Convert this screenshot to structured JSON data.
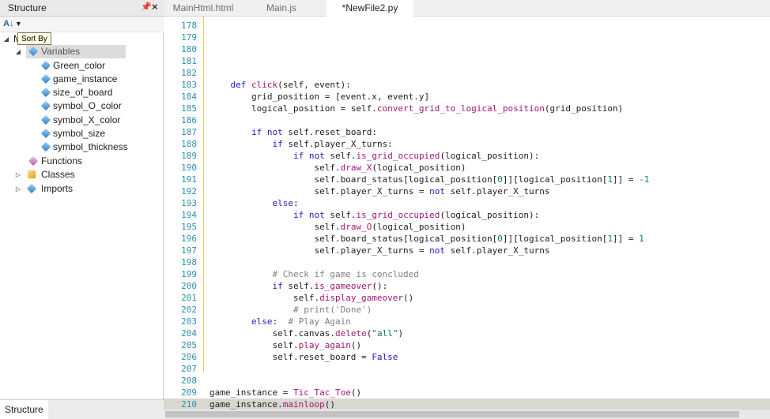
{
  "structure_panel": {
    "title": "Structure",
    "pin_icon": "pin-icon",
    "close_icon": "close-icon",
    "sort_button_tooltip": "Sort By",
    "root_label": "Main",
    "tree": [
      {
        "label": "Variables",
        "icon": "variable-icon",
        "expanded": true,
        "selected": true,
        "children": [
          "Green_color",
          "game_instance",
          "size_of_board",
          "symbol_O_color",
          "symbol_X_color",
          "symbol_size",
          "symbol_thickness"
        ]
      },
      {
        "label": "Functions",
        "icon": "function-icon"
      },
      {
        "label": "Classes",
        "icon": "class-icon",
        "collapsed": true
      },
      {
        "label": "Imports",
        "icon": "import-icon",
        "collapsed": true
      }
    ],
    "bottom_tab": "Structure"
  },
  "editor_tabs": [
    {
      "label": "MainHtml.html",
      "active": false
    },
    {
      "label": "Main.js",
      "active": false
    },
    {
      "label": "*NewFile2.py",
      "active": true
    }
  ],
  "editor": {
    "lines": [
      {
        "n": "178",
        "t": ""
      },
      {
        "n": "179",
        "t": ""
      },
      {
        "n": "180",
        "t": ""
      },
      {
        "n": "181",
        "t": ""
      },
      {
        "n": "182",
        "t": ""
      },
      {
        "n": "183",
        "t": "    def click(self, event):"
      },
      {
        "n": "184",
        "t": "        grid_position = [event.x, event.y]"
      },
      {
        "n": "185",
        "t": "        logical_position = self.convert_grid_to_logical_position(grid_position)"
      },
      {
        "n": "186",
        "t": ""
      },
      {
        "n": "187",
        "t": "        if not self.reset_board:"
      },
      {
        "n": "188",
        "t": "            if self.player_X_turns:"
      },
      {
        "n": "189",
        "t": "                if not self.is_grid_occupied(logical_position):"
      },
      {
        "n": "190",
        "t": "                    self.draw_X(logical_position)"
      },
      {
        "n": "191",
        "t": "                    self.board_status[logical_position[0]][logical_position[1]] = -1"
      },
      {
        "n": "192",
        "t": "                    self.player_X_turns = not self.player_X_turns"
      },
      {
        "n": "193",
        "t": "            else:"
      },
      {
        "n": "194",
        "t": "                if not self.is_grid_occupied(logical_position):"
      },
      {
        "n": "195",
        "t": "                    self.draw_O(logical_position)"
      },
      {
        "n": "196",
        "t": "                    self.board_status[logical_position[0]][logical_position[1]] = 1"
      },
      {
        "n": "197",
        "t": "                    self.player_X_turns = not self.player_X_turns"
      },
      {
        "n": "198",
        "t": ""
      },
      {
        "n": "199",
        "t": "            # Check if game is concluded"
      },
      {
        "n": "200",
        "t": "            if self.is_gameover():"
      },
      {
        "n": "201",
        "t": "                self.display_gameover()"
      },
      {
        "n": "202",
        "t": "                # print('Done')"
      },
      {
        "n": "203",
        "t": "        else:  # Play Again"
      },
      {
        "n": "204",
        "t": "            self.canvas.delete(\"all\")"
      },
      {
        "n": "205",
        "t": "            self.play_again()"
      },
      {
        "n": "206",
        "t": "            self.reset_board = False"
      },
      {
        "n": "207",
        "t": ""
      },
      {
        "n": "208",
        "t": ""
      },
      {
        "n": "209",
        "t": "game_instance = Tic_Tac_Toe()"
      },
      {
        "n": "210",
        "t": "game_instance.mainloop()",
        "current": true
      }
    ]
  },
  "colors": {
    "line_number": "#2b91af",
    "keyword": "#2020c0",
    "function_call": "#a3157a",
    "string": "#0b7a5a",
    "comment": "#808080",
    "fold_guide": "#f0c64a",
    "current_line": "#d8d8d0"
  }
}
